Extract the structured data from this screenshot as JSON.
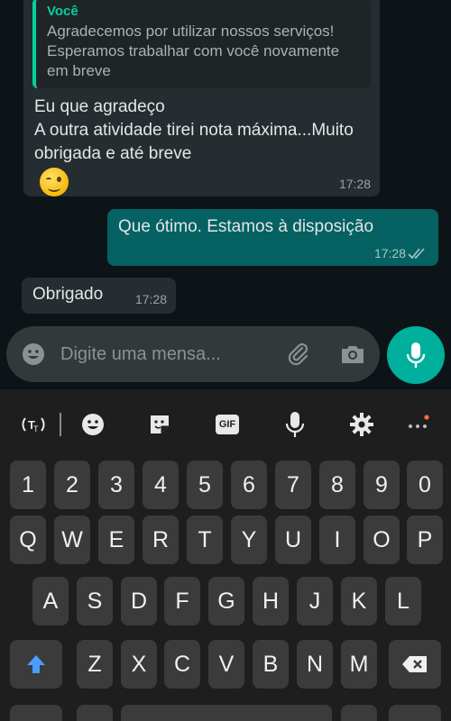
{
  "messages": [
    {
      "quote_author": "Você",
      "quote_text": "Agradecemos por utilizar nossos serviços! Esperamos trabalhar com você novamente em breve",
      "text": "Eu que agradeço\nA outra atividade tirei nota máxima...Muito obrigada e até  breve",
      "emoji": "wink-face-emoji",
      "time": "17:28"
    },
    {
      "text": "Que ótimo. Estamos à disposição",
      "time": "17:28",
      "status_icon": "double-check-icon"
    },
    {
      "text": "Obrigado",
      "time": "17:28"
    }
  ],
  "composer": {
    "placeholder": "Digite uma mensa...",
    "icons": [
      "emoji-icon",
      "paperclip-icon",
      "camera-icon",
      "microphone-icon"
    ]
  },
  "keyboard": {
    "toolbar_icons": [
      "translate-icon",
      "emoji-icon",
      "sticker-icon",
      "gif-icon",
      "voice-icon",
      "settings-icon",
      "more-icon"
    ],
    "gif_label": "GIF",
    "row_numbers": [
      "1",
      "2",
      "3",
      "4",
      "5",
      "6",
      "7",
      "8",
      "9",
      "0"
    ],
    "row_top": [
      "Q",
      "W",
      "E",
      "R",
      "T",
      "Y",
      "U",
      "I",
      "O",
      "P"
    ],
    "row_middle": [
      "A",
      "S",
      "D",
      "F",
      "G",
      "H",
      "J",
      "K",
      "L"
    ],
    "row_bottom": [
      "Z",
      "X",
      "C",
      "V",
      "B",
      "N",
      "M"
    ]
  },
  "colors": {
    "incoming_bubble": "#262d31",
    "outgoing_bubble": "#056162",
    "accent": "#00af9c",
    "quote_bar": "#06cf9c",
    "key": "#3b3b3b",
    "shift_arrow": "#4a9cff"
  }
}
